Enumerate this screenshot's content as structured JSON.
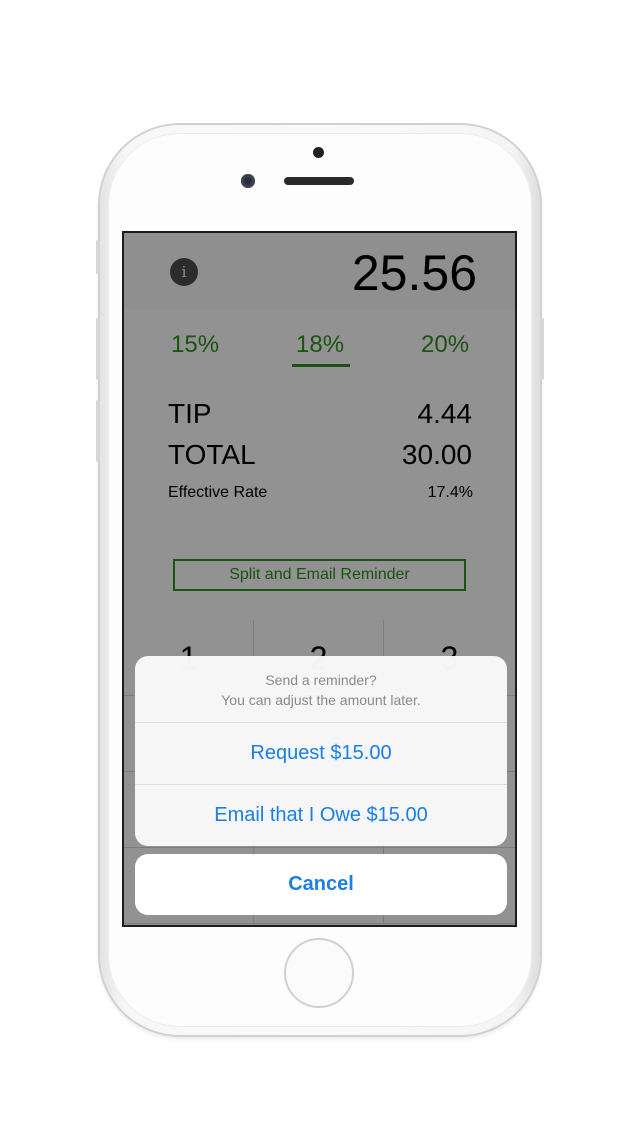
{
  "bill": {
    "amount": "25.56",
    "info_label": "i"
  },
  "tip_options": [
    {
      "label": "15%",
      "selected": false
    },
    {
      "label": "18%",
      "selected": true
    },
    {
      "label": "20%",
      "selected": false
    }
  ],
  "results": {
    "tip_label": "TIP",
    "tip_value": "4.44",
    "total_label": "TOTAL",
    "total_value": "30.00",
    "rate_label": "Effective Rate",
    "rate_value": "17.4%"
  },
  "split_button": "Split and Email Reminder",
  "keypad": {
    "keys": [
      "1",
      "2",
      "3"
    ]
  },
  "action_sheet": {
    "title": "Send a reminder?",
    "message": "You can adjust the amount later.",
    "actions": [
      "Request $15.00",
      "Email that I Owe $15.00"
    ],
    "cancel": "Cancel"
  },
  "colors": {
    "accent_green": "#2e8b1e",
    "ios_blue": "#1a7fe6"
  }
}
